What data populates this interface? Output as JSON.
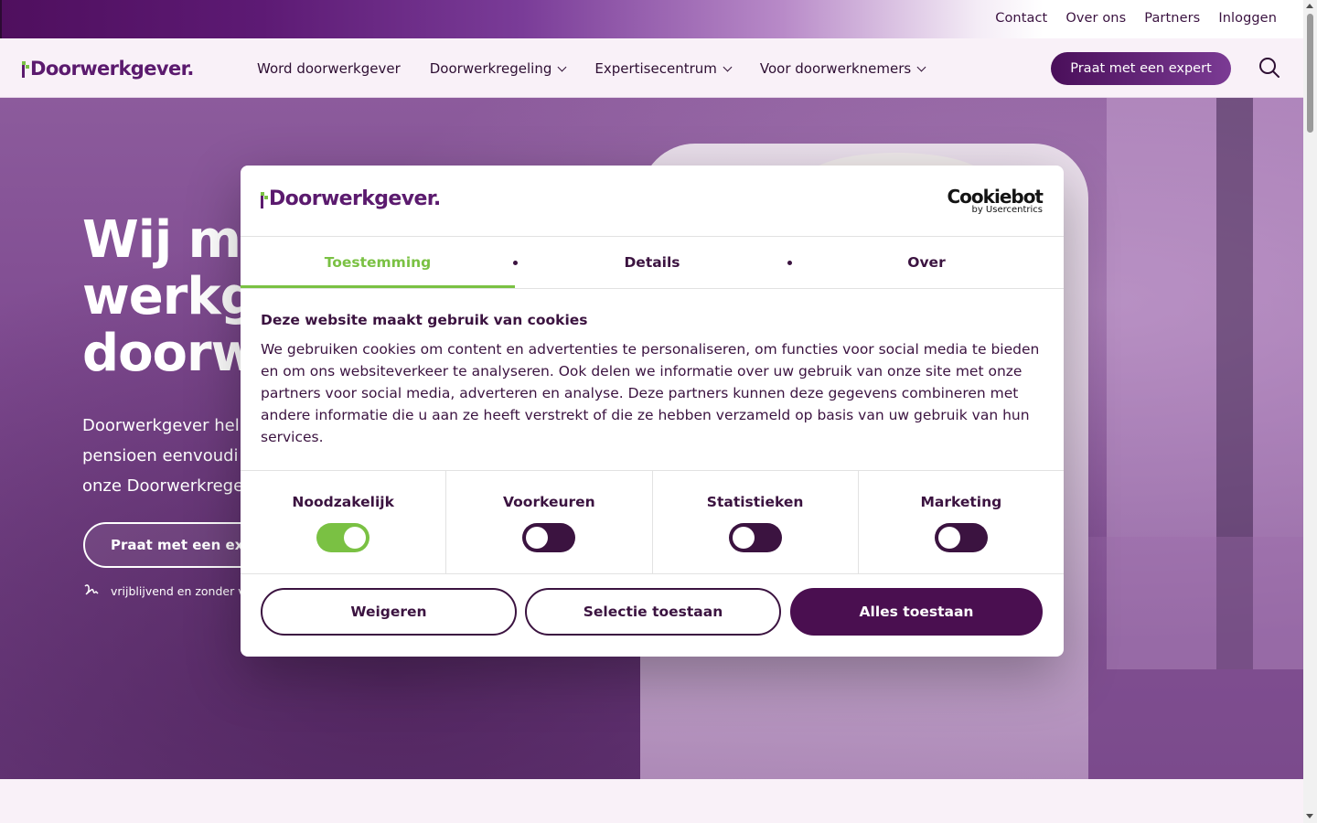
{
  "topbar": {
    "links": [
      "Contact",
      "Over ons",
      "Partners",
      "Inloggen"
    ]
  },
  "nav": {
    "logo": "Doorwerkgever.",
    "items": [
      {
        "label": "Word doorwerkgever",
        "dropdown": false
      },
      {
        "label": "Doorwerkregeling",
        "dropdown": true
      },
      {
        "label": "Expertisecentrum",
        "dropdown": true
      },
      {
        "label": "Voor doorwerknemers",
        "dropdown": true
      }
    ],
    "cta": "Praat met een expert"
  },
  "hero": {
    "title_lines": [
      "Wij ma",
      "werkge",
      "doorwe"
    ],
    "intro_lines": [
      "Doorwerkgever help",
      "pensioen eenvoudi",
      "onze Doorwerkrege"
    ],
    "button": "Praat met een exp",
    "note": "vrijblijvend en zonder ve"
  },
  "cookie": {
    "logo": "Doorwerkgever.",
    "provider": "Cookiebot",
    "provider_sub": "by Usercentrics",
    "tabs": [
      "Toestemming",
      "Details",
      "Over"
    ],
    "heading": "Deze website maakt gebruik van cookies",
    "description": "We gebruiken cookies om content en advertenties te personaliseren, om functies voor social media te bieden en om ons websiteverkeer te analyseren. Ook delen we informatie over uw gebruik van onze site met onze partners voor social media, adverteren en analyse. Deze partners kunnen deze gegevens combineren met andere informatie die u aan ze heeft verstrekt of die ze hebben verzameld op basis van uw gebruik van hun services.",
    "toggles": [
      {
        "label": "Noodzakelijk",
        "on": true
      },
      {
        "label": "Voorkeuren",
        "on": false
      },
      {
        "label": "Statistieken",
        "on": false
      },
      {
        "label": "Marketing",
        "on": false
      }
    ],
    "buttons": {
      "reject": "Weigeren",
      "selection": "Selectie toestaan",
      "accept_all": "Alles toestaan"
    }
  },
  "colors": {
    "brand_purple": "#5b1a6e",
    "dark_purple": "#3b1340",
    "accent_green": "#7ac143"
  }
}
